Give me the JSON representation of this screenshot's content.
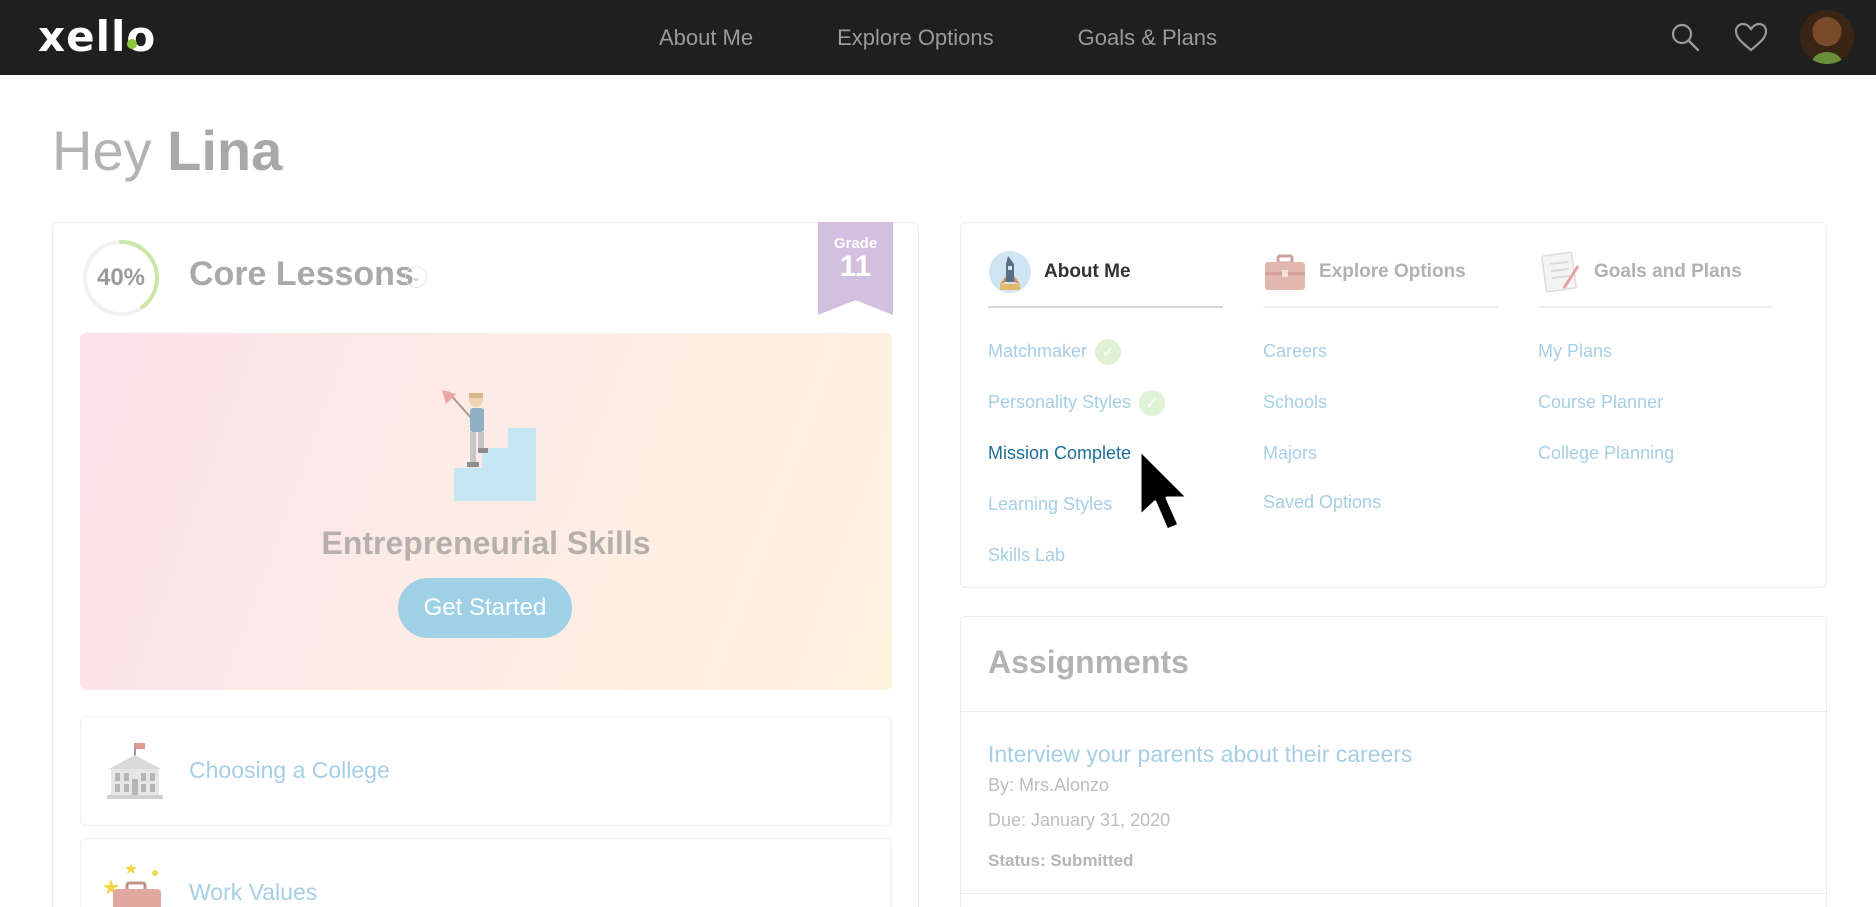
{
  "app": {
    "logo_text": "xello"
  },
  "nav": {
    "links": [
      "About Me",
      "Explore Options",
      "Goals & Plans"
    ],
    "icons": [
      "search-icon",
      "heart-icon",
      "avatar"
    ]
  },
  "greeting": {
    "prefix": "Hey",
    "name": "Lina"
  },
  "core_lessons": {
    "progress_label": "40%",
    "progress_value": 0.4,
    "title": "Core Lessons",
    "grade_label": "Grade",
    "grade_value": "11",
    "featured": {
      "title": "Entrepreneurial Skills",
      "button": "Get Started"
    },
    "lessons": [
      {
        "label": "Choosing a College",
        "icon": "college-building-icon"
      },
      {
        "label": "Work Values",
        "icon": "briefcase-stars-icon"
      }
    ]
  },
  "menu": {
    "columns": [
      {
        "title": "About Me",
        "icon": "rocket-globe-icon",
        "items": [
          {
            "label": "Matchmaker",
            "completed": true
          },
          {
            "label": "Personality Styles",
            "completed": true
          },
          {
            "label": "Mission Complete",
            "completed": false,
            "active": true
          },
          {
            "label": "Learning Styles",
            "completed": false
          },
          {
            "label": "Skills Lab",
            "completed": false
          }
        ]
      },
      {
        "title": "Explore Options",
        "icon": "briefcase-icon",
        "items": [
          {
            "label": "Careers"
          },
          {
            "label": "Schools"
          },
          {
            "label": "Majors"
          },
          {
            "label": "Saved Options"
          }
        ]
      },
      {
        "title": "Goals and Plans",
        "icon": "checklist-icon",
        "items": [
          {
            "label": "My Plans"
          },
          {
            "label": "Course Planner"
          },
          {
            "label": "College Planning"
          }
        ]
      }
    ]
  },
  "assignments": {
    "title": "Assignments",
    "items": [
      {
        "title": "Interview your parents about their careers",
        "by": "By: Mrs.Alonzo",
        "due": "Due: January 31, 2020",
        "status": "Status: Submitted"
      }
    ]
  },
  "colors": {
    "topbar": "#1f1f1f",
    "link": "#a6cfe4",
    "link_active": "#1b6f97",
    "progress_ring": "#c9e7a6",
    "grade_ribbon": "#d3bfe0",
    "button": "#9fd0e6"
  }
}
